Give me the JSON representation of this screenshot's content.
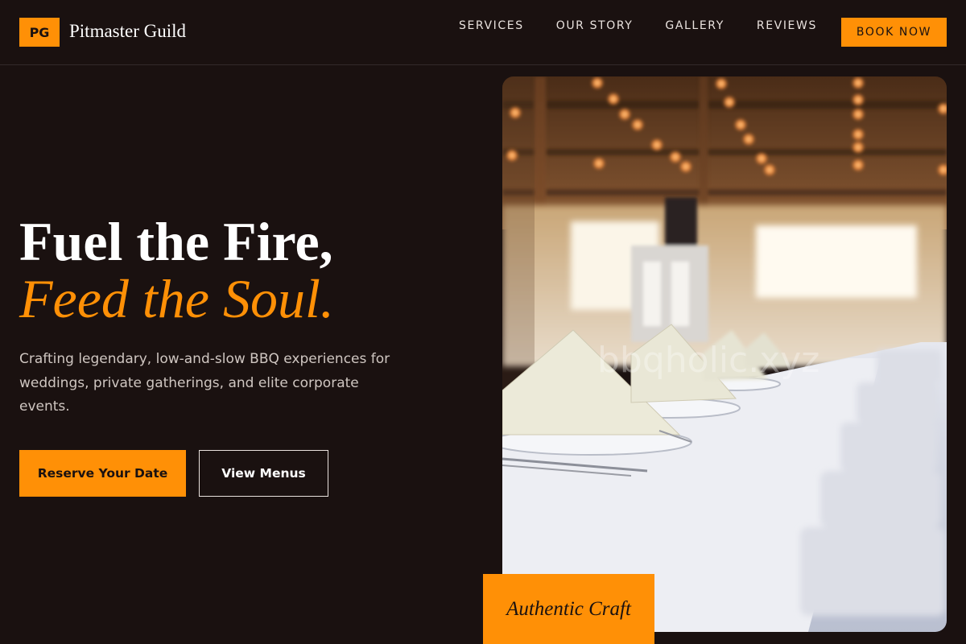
{
  "brand": {
    "badge": "PG",
    "name": "Pitmaster Guild"
  },
  "nav": {
    "items": [
      "SERVICES",
      "OUR STORY",
      "GALLERY",
      "REVIEWS"
    ],
    "cta": "BOOK NOW"
  },
  "hero": {
    "title_line1": "Fuel the Fire,",
    "title_line2": "Feed the Soul.",
    "description": "Crafting legendary, low-and-slow BBQ experiences for weddings, private gatherings, and elite corporate events.",
    "primary_button": "Reserve Your Date",
    "secondary_button": "View Menus"
  },
  "photo": {
    "watermark": "bbqholic.xyz",
    "badge": "Authentic Craft"
  },
  "colors": {
    "background": "#1a1110",
    "accent": "#ff9006",
    "text": "#ffffff",
    "muted": "#cfc6c1"
  }
}
